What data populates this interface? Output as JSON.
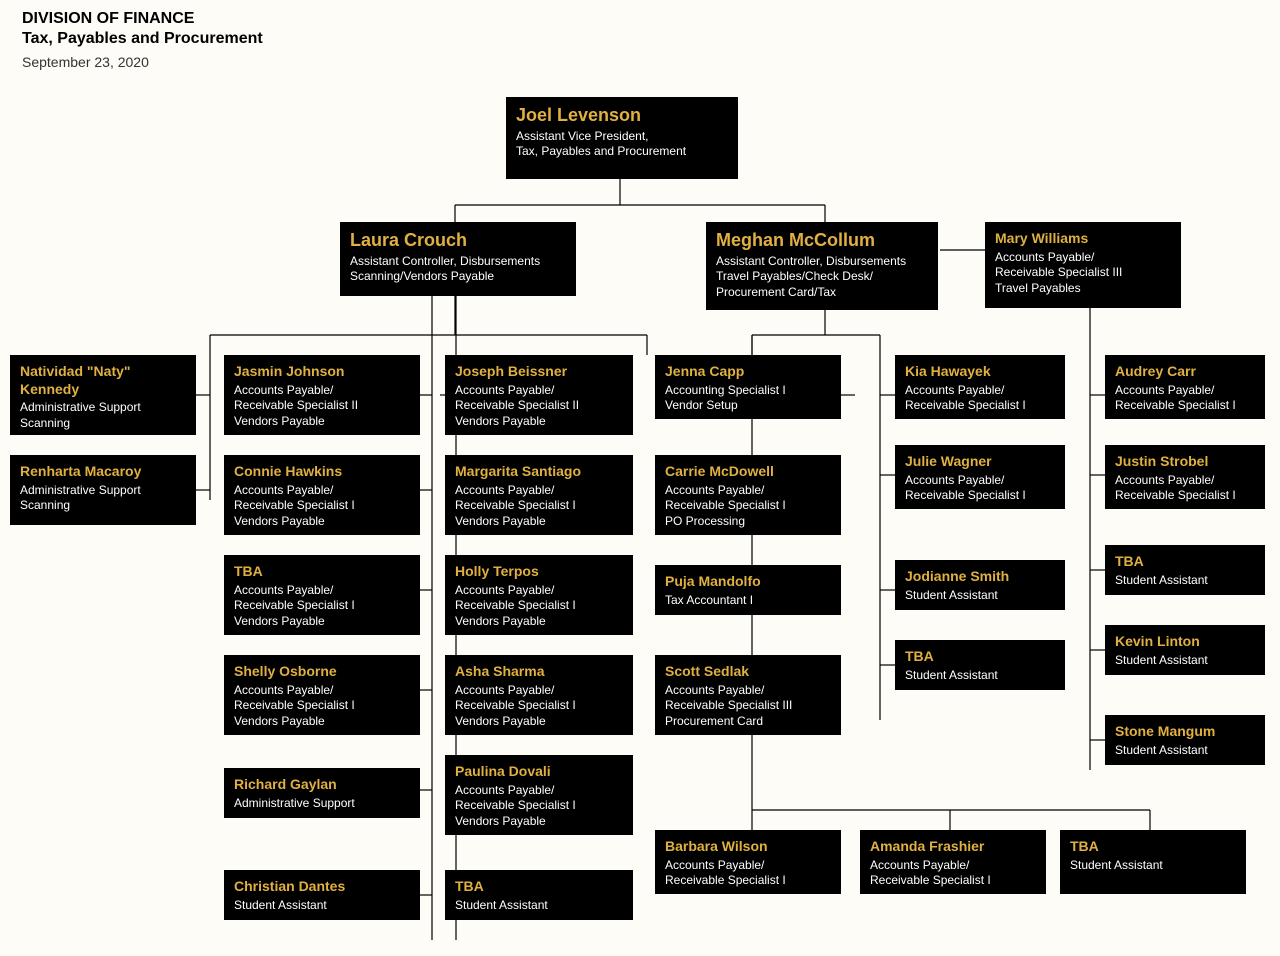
{
  "header": {
    "line1": "DIVISION OF FINANCE",
    "line2": "Tax, Payables and Procurement",
    "date": "September 23, 2020"
  },
  "colors": {
    "accent": "#e0b040",
    "box": "#000000",
    "text": "#ffffff"
  },
  "nodes": {
    "joel": {
      "name": "Joel Levenson",
      "role": "Assistant Vice President,\nTax, Payables and Procurement"
    },
    "laura": {
      "name": "Laura Crouch",
      "role": "Assistant Controller, Disbursements\nScanning/Vendors Payable"
    },
    "meghan": {
      "name": "Meghan McCollum",
      "role": "Assistant Controller, Disbursements\nTravel Payables/Check Desk/\nProcurement Card/Tax"
    },
    "mary": {
      "name": "Mary Williams",
      "role": "Accounts Payable/\nReceivable Specialist III\nTravel Payables"
    },
    "c0_0": {
      "name": "Natividad \"Naty\" Kennedy",
      "role": "Administrative Support\nScanning"
    },
    "c0_1": {
      "name": "Renharta Macaroy",
      "role": "Administrative Support\nScanning"
    },
    "c1_0": {
      "name": "Jasmin Johnson",
      "role": "Accounts Payable/\nReceivable Specialist II\nVendors Payable"
    },
    "c1_1": {
      "name": "Connie Hawkins",
      "role": "Accounts Payable/\nReceivable Specialist I\nVendors Payable"
    },
    "c1_2": {
      "name": "TBA",
      "role": "Accounts Payable/\nReceivable Specialist I\nVendors Payable"
    },
    "c1_3": {
      "name": "Shelly Osborne",
      "role": "Accounts Payable/\nReceivable Specialist I\nVendors Payable"
    },
    "c1_4": {
      "name": "Richard Gaylan",
      "role": "Administrative Support"
    },
    "c1_5": {
      "name": "Christian Dantes",
      "role": "Student Assistant"
    },
    "c2_0": {
      "name": "Joseph Beissner",
      "role": "Accounts Payable/\nReceivable Specialist II\nVendors Payable"
    },
    "c2_1": {
      "name": "Margarita Santiago",
      "role": "Accounts Payable/\nReceivable Specialist I\nVendors Payable"
    },
    "c2_2": {
      "name": "Holly Terpos",
      "role": "Accounts Payable/\nReceivable Specialist I\nVendors Payable"
    },
    "c2_3": {
      "name": "Asha Sharma",
      "role": "Accounts Payable/\nReceivable Specialist I\nVendors Payable"
    },
    "c2_4": {
      "name": "Paulina Dovali",
      "role": "Accounts Payable/\nReceivable Specialist I\nVendors Payable"
    },
    "c2_5": {
      "name": "TBA",
      "role": "Student Assistant"
    },
    "c3_0": {
      "name": "Jenna Capp",
      "role": "Accounting Specialist I\nVendor Setup"
    },
    "c3_1": {
      "name": "Carrie McDowell",
      "role": "Accounts Payable/\nReceivable Specialist I\nPO Processing"
    },
    "c3_2": {
      "name": "Puja Mandolfo",
      "role": "Tax Accountant I"
    },
    "c3_3": {
      "name": "Scott Sedlak",
      "role": "Accounts Payable/\nReceivable Specialist III\nProcurement Card"
    },
    "c4_0": {
      "name": "Kia Hawayek",
      "role": "Accounts Payable/\nReceivable Specialist I"
    },
    "c4_1": {
      "name": "Julie Wagner",
      "role": "Accounts Payable/\nReceivable Specialist I"
    },
    "c4_2": {
      "name": "Jodianne Smith",
      "role": "Student Assistant"
    },
    "c4_3": {
      "name": "TBA",
      "role": "Student Assistant"
    },
    "c5_0": {
      "name": "Audrey Carr",
      "role": "Accounts Payable/\nReceivable Specialist I"
    },
    "c5_1": {
      "name": "Justin Strobel",
      "role": "Accounts Payable/\nReceivable Specialist I"
    },
    "c5_2": {
      "name": "TBA",
      "role": "Student Assistant"
    },
    "c5_3": {
      "name": "Kevin Linton",
      "role": "Student Assistant"
    },
    "c5_4": {
      "name": "Stone Mangum",
      "role": "Student Assistant"
    },
    "s0": {
      "name": "Barbara Wilson",
      "role": "Accounts Payable/\nReceivable Specialist I"
    },
    "s1": {
      "name": "Amanda Frashier",
      "role": "Accounts Payable/\nReceivable Specialist I"
    },
    "s2": {
      "name": "TBA",
      "role": "Student Assistant"
    }
  }
}
